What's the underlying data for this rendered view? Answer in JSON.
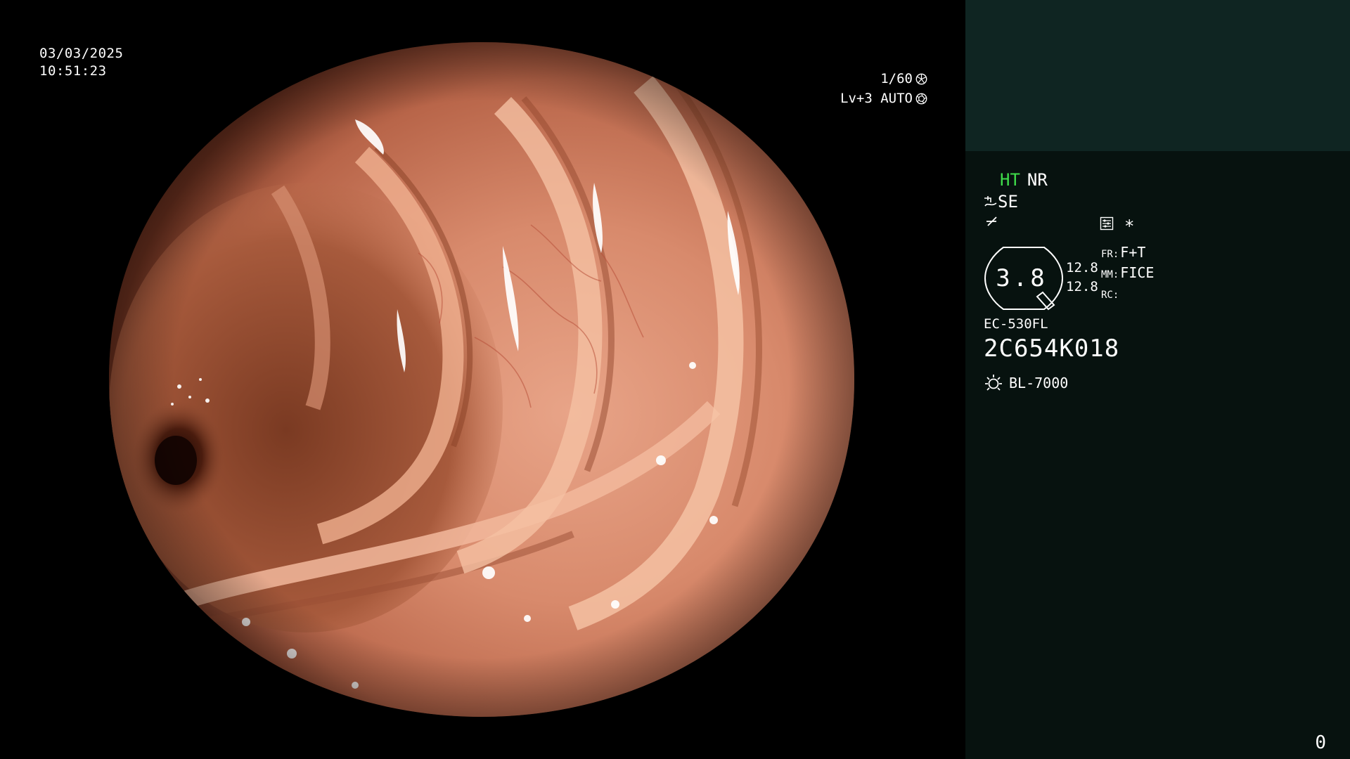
{
  "osd": {
    "date": "03/03/2025",
    "time": "10:51:23",
    "shutter": "1/60",
    "shutter_icon": "shutter-icon",
    "iris": "Lv+3 AUTO",
    "iris_icon": "iris-icon"
  },
  "panel": {
    "mode_ht": "HT",
    "mode_nr": "NR",
    "structure_enhance": "SE",
    "structure_icon": "structure-enhance-icon",
    "color_icon": "color-enhance-icon",
    "memory_icon": "memory-icon",
    "asterisk": "*",
    "zoom_value": "3.8",
    "stat_1": "12.8",
    "stat_2": "12.8",
    "fr_label": "FR:",
    "fr_value": "F+T",
    "mm_label": "MM:",
    "mm_value": "FICE",
    "rc_label": "RC:",
    "rc_value": "",
    "scope_model": "EC-530FL",
    "scope_serial": "2C654K018",
    "light_source": "BL-7000",
    "light_icon": "lamp-icon",
    "counter": "0"
  },
  "colors": {
    "panel_bg": "#07120f",
    "panel_header_bg": "#0f2522",
    "ht_green": "#3fdc4a",
    "text": "#ffffff"
  }
}
